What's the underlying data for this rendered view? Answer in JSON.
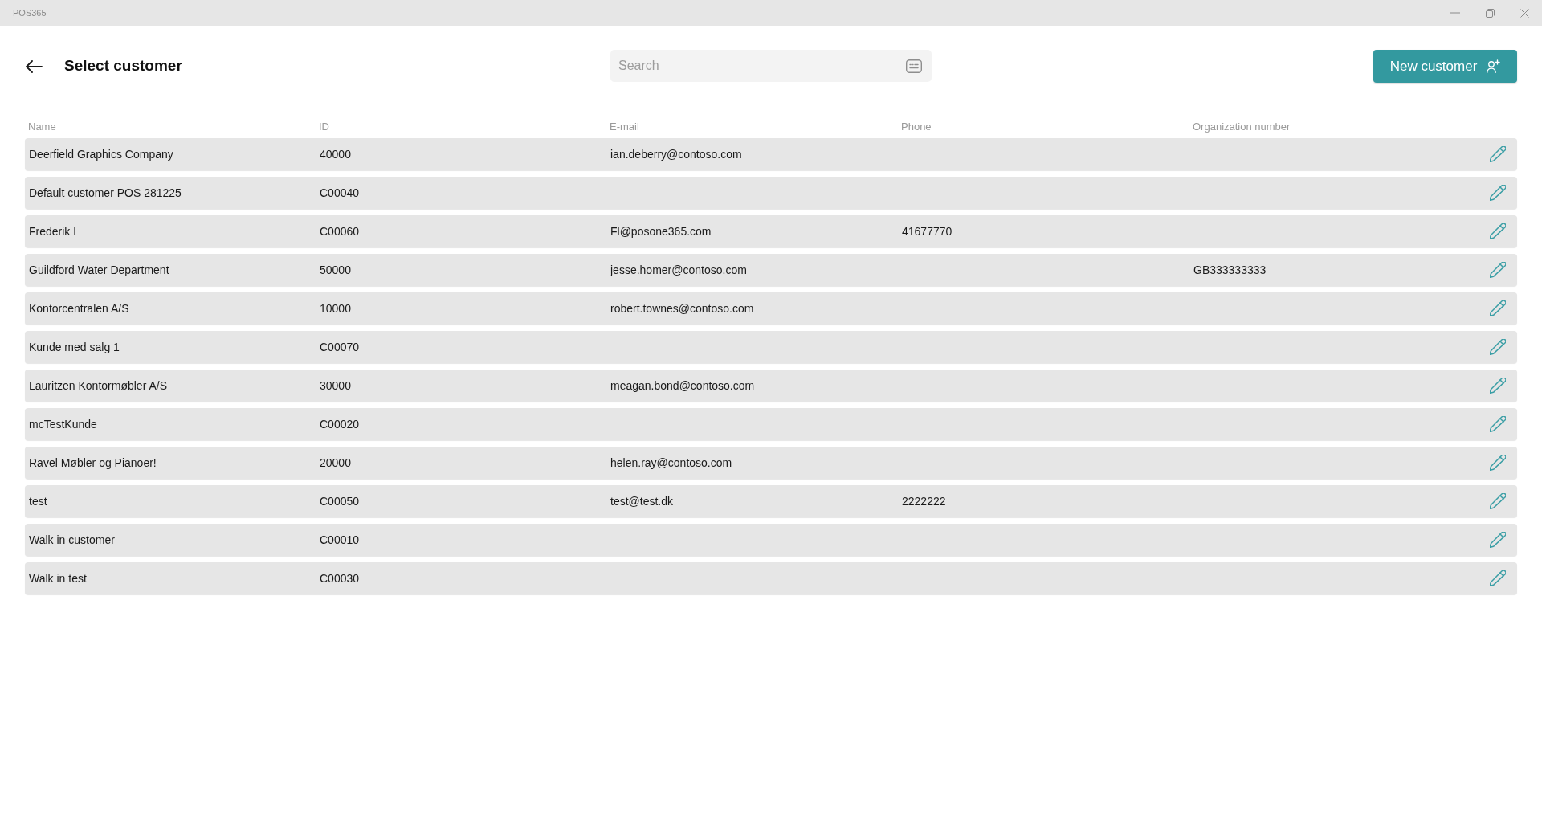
{
  "window": {
    "title": "POS365"
  },
  "header": {
    "title": "Select customer"
  },
  "search": {
    "placeholder": "Search"
  },
  "new_customer_button": {
    "label": "New customer"
  },
  "table": {
    "columns": [
      "Name",
      "ID",
      "E-mail",
      "Phone",
      "Organization number"
    ],
    "rows": [
      {
        "name": "Deerfield Graphics Company",
        "id": "40000",
        "email": "ian.deberry@contoso.com"
      },
      {
        "name": "Default customer POS 281225",
        "id": "C00040"
      },
      {
        "name": "Frederik L",
        "id": "C00060",
        "email": "Fl@posone365.com",
        "phone": "41677770"
      },
      {
        "name": "Guildford Water Department",
        "id": "50000",
        "email": "jesse.homer@contoso.com",
        "organization_number": "GB333333333"
      },
      {
        "name": "Kontorcentralen A/S",
        "id": "10000",
        "email": "robert.townes@contoso.com"
      },
      {
        "name": "Kunde med salg 1",
        "id": "C00070"
      },
      {
        "name": "Lauritzen Kontormøbler A/S",
        "id": "30000",
        "email": "meagan.bond@contoso.com"
      },
      {
        "name": "mcTestKunde",
        "id": "C00020"
      },
      {
        "name": "Ravel Møbler og Pianoer!",
        "id": "20000",
        "email": "helen.ray@contoso.com"
      },
      {
        "name": "test",
        "id": "C00050",
        "email": "test@test.dk",
        "phone": "2222222"
      },
      {
        "name": "Walk in customer",
        "id": "C00010"
      },
      {
        "name": "Walk in test",
        "id": "C00030"
      }
    ]
  }
}
